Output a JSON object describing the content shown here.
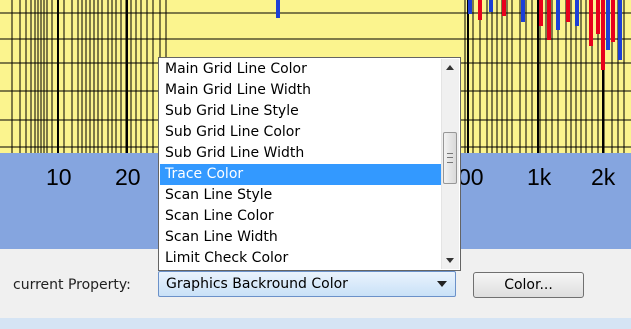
{
  "plot": {
    "axis_ticks": [
      "10",
      "20",
      "00",
      "1k",
      "2k"
    ],
    "colors": {
      "background": "#fbf48e",
      "grid": "#000000",
      "axis_band": "#85a5df",
      "trace_red": "#e8001c",
      "trace_blue": "#1d3fd6"
    }
  },
  "dropdown": {
    "items": [
      "Main Grid Line Color",
      "Main Grid Line Width",
      "Sub Grid Line Style",
      "Sub Grid Line Color",
      "Sub Grid Line Width",
      "Trace Color",
      "Scan Line Style",
      "Scan Line Color",
      "Scan Line Width",
      "Limit Check Color"
    ],
    "selected_index": 5,
    "icons": [
      "scroll-up-arrow-icon",
      "scroll-down-arrow-icon"
    ]
  },
  "property_bar": {
    "label": "current Property:",
    "selected_value": "Graphics Backround Color",
    "color_button_label": "Color..."
  }
}
